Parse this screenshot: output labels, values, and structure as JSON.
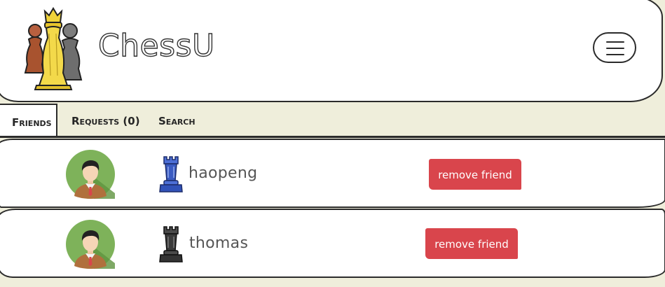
{
  "header": {
    "brand": "ChessU"
  },
  "tabs": [
    {
      "label": "Friends",
      "active": true
    },
    {
      "label": "Requests (0)",
      "active": false
    },
    {
      "label": "Search",
      "active": false
    }
  ],
  "friends": [
    {
      "username": "haopeng",
      "piece": "blue-rook-icon",
      "action_label": "remove friend"
    },
    {
      "username": "thomas",
      "piece": "black-rook-icon",
      "action_label": "remove friend"
    }
  ],
  "colors": {
    "background": "#efeedb",
    "accent_button": "#d9454c",
    "border": "#2b2b2b"
  }
}
